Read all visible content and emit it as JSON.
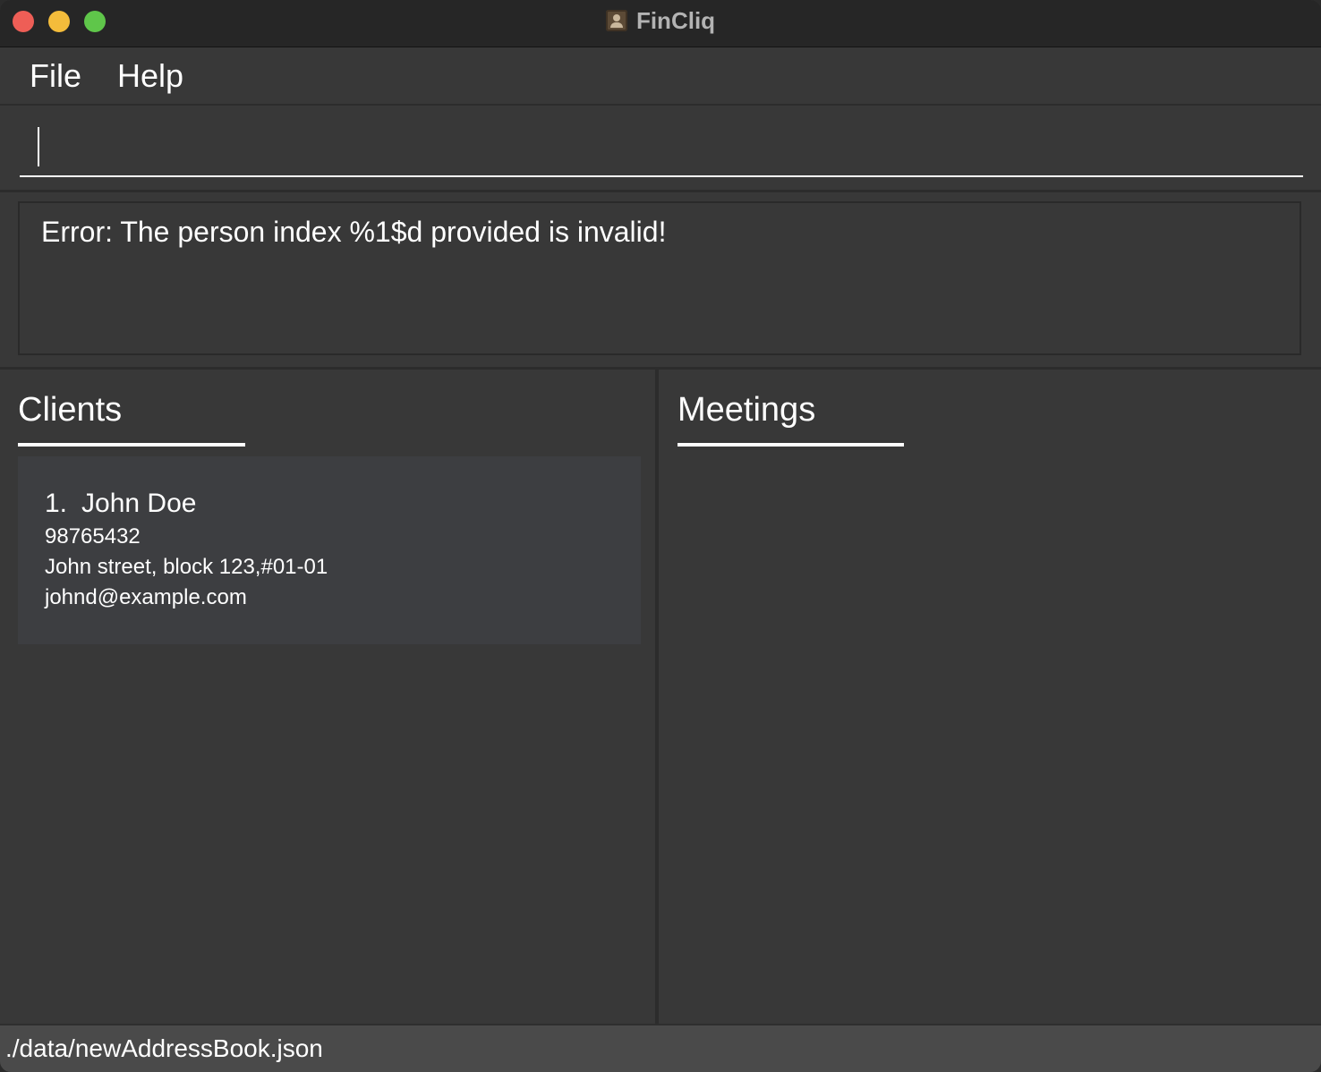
{
  "window": {
    "title": "FinCliq",
    "icon": "contact-card-icon"
  },
  "menu": {
    "items": [
      {
        "label": "File"
      },
      {
        "label": "Help"
      }
    ]
  },
  "command": {
    "value": "",
    "placeholder": ""
  },
  "result": {
    "message": "Error: The person index %1$d provided is invalid!"
  },
  "clients_panel": {
    "title": "Clients",
    "items": [
      {
        "index": "1.",
        "name": "John Doe",
        "phone": "98765432",
        "address": "John street, block 123,#01-01",
        "email": "johnd@example.com"
      }
    ]
  },
  "meetings_panel": {
    "title": "Meetings",
    "items": []
  },
  "status_bar": {
    "path": "./data/newAddressBook.json"
  },
  "colors": {
    "background": "#383838",
    "titlebar": "#262626",
    "card": "#3d3e41",
    "text": "#ffffff"
  }
}
